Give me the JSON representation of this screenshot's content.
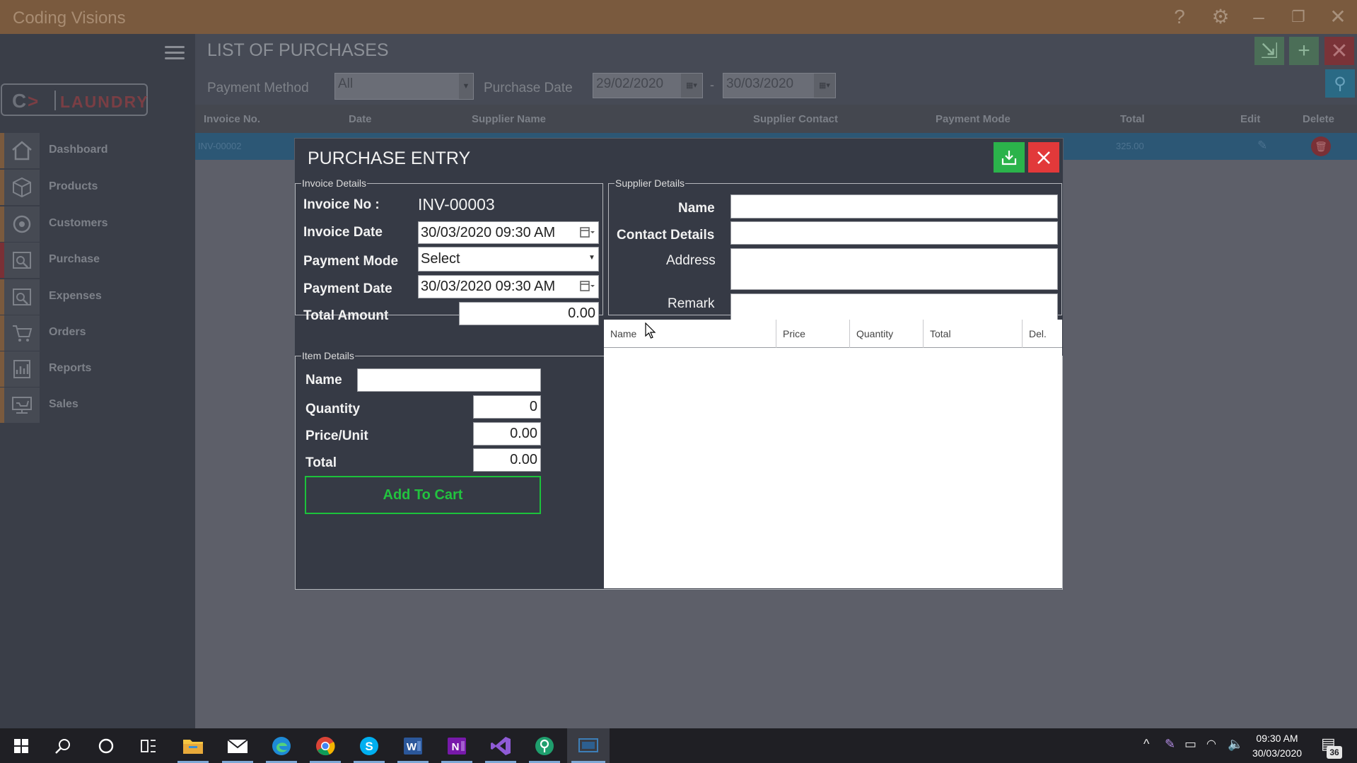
{
  "app": {
    "title": "Coding Visions"
  },
  "titlebar_icons": [
    "help-icon",
    "gear-icon",
    "minimize-icon",
    "maximize-icon",
    "close-icon"
  ],
  "sidebar": {
    "logo": {
      "letter": "C",
      "word": "LAUNDRY"
    },
    "items": [
      {
        "label": "Dashboard",
        "icon": "home-icon"
      },
      {
        "label": "Products",
        "icon": "box-icon"
      },
      {
        "label": "Customers",
        "icon": "customers-icon"
      },
      {
        "label": "Purchase",
        "icon": "purchase-icon"
      },
      {
        "label": "Expenses",
        "icon": "expenses-icon"
      },
      {
        "label": "Orders",
        "icon": "orders-icon"
      },
      {
        "label": "Reports",
        "icon": "reports-icon"
      },
      {
        "label": "Sales",
        "icon": "sales-icon"
      }
    ]
  },
  "list_page": {
    "title": "LIST OF PURCHASES",
    "filters": {
      "payment_method_label": "Payment Method",
      "payment_method_value": "All",
      "purchase_date_label": "Purchase Date",
      "date_from": "29/02/2020",
      "date_separator": "-",
      "date_to": "30/03/2020"
    },
    "columns": [
      "Invoice No.",
      "Date",
      "Supplier Name",
      "Supplier Contact",
      "Payment Mode",
      "Total",
      "Edit",
      "Delete"
    ],
    "rows": [
      {
        "invoice_no": "INV-00002",
        "total": "325.00"
      }
    ]
  },
  "modal": {
    "title": "PURCHASE ENTRY",
    "invoice_details": {
      "legend": "Invoice Details",
      "invoice_no_label": "Invoice No :",
      "invoice_no_value": "INV-00003",
      "invoice_date_label": "Invoice Date",
      "invoice_date_value": "30/03/2020  09:30 AM",
      "payment_mode_label": "Payment Mode",
      "payment_mode_value": "Select",
      "payment_date_label": "Payment Date",
      "payment_date_value": "30/03/2020  09:30 AM",
      "total_amount_label": "Total Amount",
      "total_amount_value": "0.00"
    },
    "supplier_details": {
      "legend": "Supplier Details",
      "name_label": "Name",
      "contact_label": "Contact Details",
      "address_label": "Address",
      "remark_label": "Remark"
    },
    "item_details": {
      "legend": "Item Details",
      "name_label": "Name",
      "quantity_label": "Quantity",
      "quantity_value": "0",
      "price_label": "Price/Unit",
      "price_value": "0.00",
      "total_label": "Total",
      "total_value": "0.00",
      "add_button": "Add To Cart"
    },
    "cart_columns": [
      "Name",
      "Price",
      "Quantity",
      "Total",
      "Del."
    ]
  },
  "taskbar": {
    "apps": [
      "windows-start-icon",
      "search-icon",
      "cortana-icon",
      "task-view-icon",
      "file-explorer-icon",
      "mail-icon",
      "edge-icon",
      "chrome-icon",
      "skype-icon",
      "word-icon",
      "onenote-icon",
      "visual-studio-icon",
      "maps-icon",
      "laundry-app-icon"
    ],
    "time": "09:30 AM",
    "date": "30/03/2020",
    "notification_count": "36"
  },
  "colors": {
    "titlebar": "#7a5a3e",
    "modal_bg": "#363a45",
    "save_green": "#2bb34b",
    "close_red": "#e2393a",
    "add_to_cart_green": "#22c33f"
  }
}
